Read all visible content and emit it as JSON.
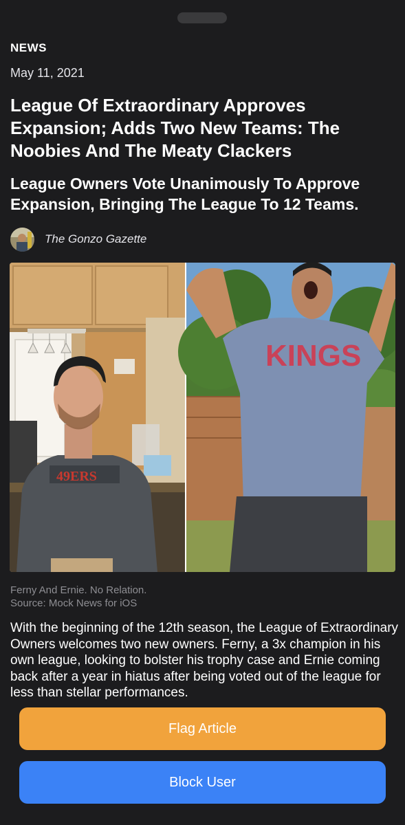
{
  "article": {
    "section": "NEWS",
    "date": "May 11, 2021",
    "headline": "League Of Extraordinary Approves Expansion; Adds Two New Teams: The Noobies And The Meaty Clackers",
    "subheadline": "League Owners Vote Unanimously To Approve Expansion, Bringing The League To 12 Teams.",
    "author": "The Gonzo Gazette",
    "caption_line1": "Ferny And Ernie. No Relation.",
    "caption_line2": "Source: Mock News for iOS",
    "body": "With the beginning of the 12th season, the League of Extraordinary Owners welcomes two new owners.  Ferny, a 3x champion in his own league, looking to bolster his trophy case and Ernie coming back after a year in hiatus after being voted out of the league for less than stellar performances.",
    "photo_left_shirt_text": "49ERS",
    "photo_right_shirt_text": "KINGS"
  },
  "actions": {
    "flag_label": "Flag Article",
    "block_label": "Block User"
  },
  "colors": {
    "background": "#1c1c1e",
    "flag_button": "#f1a33c",
    "block_button": "#3b82f6",
    "caption": "#8e8e93"
  }
}
